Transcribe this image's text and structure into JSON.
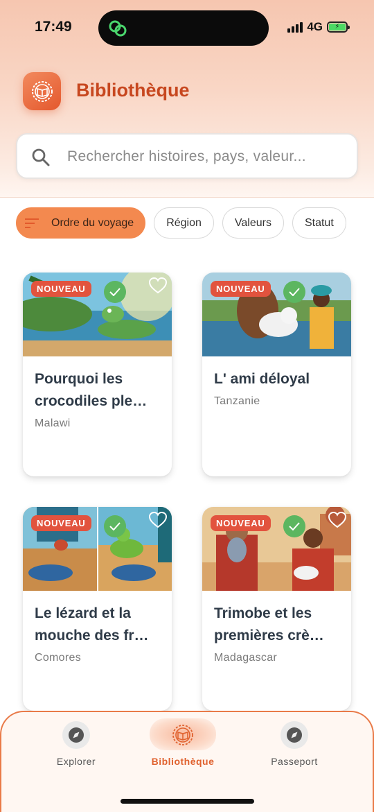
{
  "status_bar": {
    "time": "17:49",
    "network": "4G"
  },
  "header": {
    "title": "Bibliothèque"
  },
  "search": {
    "placeholder": "Rechercher histoires, pays, valeur..."
  },
  "filters": [
    {
      "label": "Ordre du voyage",
      "active": true
    },
    {
      "label": "Région",
      "active": false
    },
    {
      "label": "Valeurs",
      "active": false
    },
    {
      "label": "Statut",
      "active": false
    }
  ],
  "stories": [
    {
      "title": "Pourquoi les crocodiles ple…",
      "country": "Malawi",
      "badge": "NOUVEAU",
      "completed": true,
      "favorite": false
    },
    {
      "title": "L' ami déloyal",
      "country": "Tanzanie",
      "badge": "NOUVEAU",
      "completed": true,
      "favorite": false
    },
    {
      "title": "Le lézard et la mouche des fr…",
      "country": "Comores",
      "badge": "NOUVEAU",
      "completed": true,
      "favorite": false
    },
    {
      "title": "Trimobe et les premières crè…",
      "country": "Madagascar",
      "badge": "NOUVEAU",
      "completed": true,
      "favorite": false
    }
  ],
  "nav": {
    "items": [
      {
        "label": "Explorer",
        "icon": "compass-icon",
        "active": false
      },
      {
        "label": "Bibliothèque",
        "icon": "book-icon",
        "active": true
      },
      {
        "label": "Passeport",
        "icon": "compass-icon",
        "active": false
      }
    ]
  },
  "colors": {
    "accent": "#e0622f",
    "badge": "#e2533e",
    "check": "#5cb660",
    "chip_active": "#f3894f"
  }
}
